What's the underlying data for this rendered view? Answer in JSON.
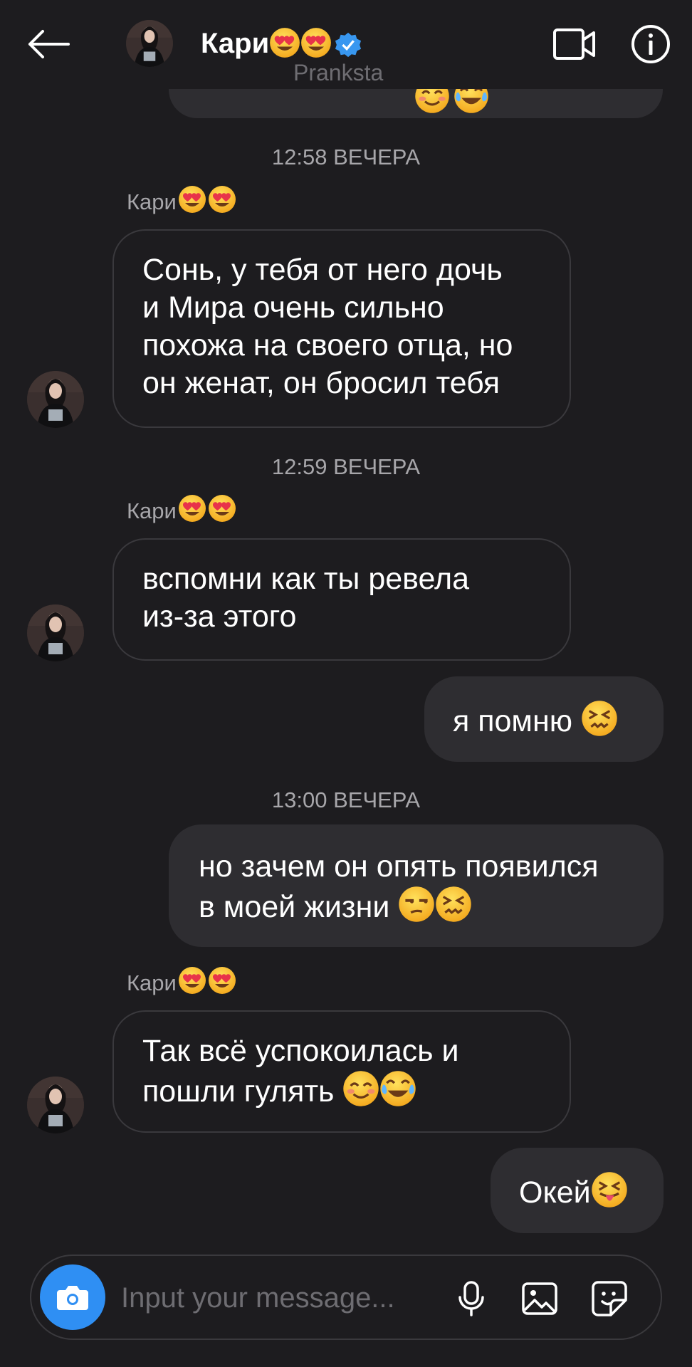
{
  "header": {
    "name": "Кари",
    "username": "Pranksta"
  },
  "thread": [
    {
      "type": "timestamp",
      "text": "12:58 ВЕЧЕРА"
    },
    {
      "type": "sender",
      "text": "Кари"
    },
    {
      "type": "incoming",
      "lines": [
        "Сонь, у тебя от него дочь",
        "и Мира очень сильно",
        "похожа на своего отца, но",
        "он женат, он бросил тебя"
      ]
    },
    {
      "type": "timestamp",
      "text": "12:59 ВЕЧЕРА"
    },
    {
      "type": "sender",
      "text": "Кари"
    },
    {
      "type": "incoming",
      "lines": [
        "вспомни как ты ревела",
        "из-за этого"
      ]
    },
    {
      "type": "outgoing",
      "lines": [
        "я помню "
      ]
    },
    {
      "type": "timestamp",
      "text": "13:00 ВЕЧЕРА"
    },
    {
      "type": "outgoing",
      "lines": [
        "но зачем он опять появился",
        "в моей жизни "
      ]
    },
    {
      "type": "sender",
      "text": "Кари"
    },
    {
      "type": "incoming",
      "lines": [
        "Так всё успокоилась и",
        "пошли гулять "
      ]
    },
    {
      "type": "outgoing",
      "lines": [
        "Окей"
      ]
    }
  ],
  "composer": {
    "placeholder": "Input your message..."
  },
  "colors": {
    "background": "#1d1c1f",
    "bubble_outgoing": "#2e2d31",
    "bubble_incoming_border": "#3a393d",
    "accent": "#2f8ff3",
    "muted_text": "#a7a6aa"
  },
  "icons": [
    "back-arrow-icon",
    "verified-badge-icon",
    "video-call-icon",
    "info-icon",
    "camera-icon",
    "microphone-icon",
    "gallery-icon",
    "sticker-icon"
  ]
}
